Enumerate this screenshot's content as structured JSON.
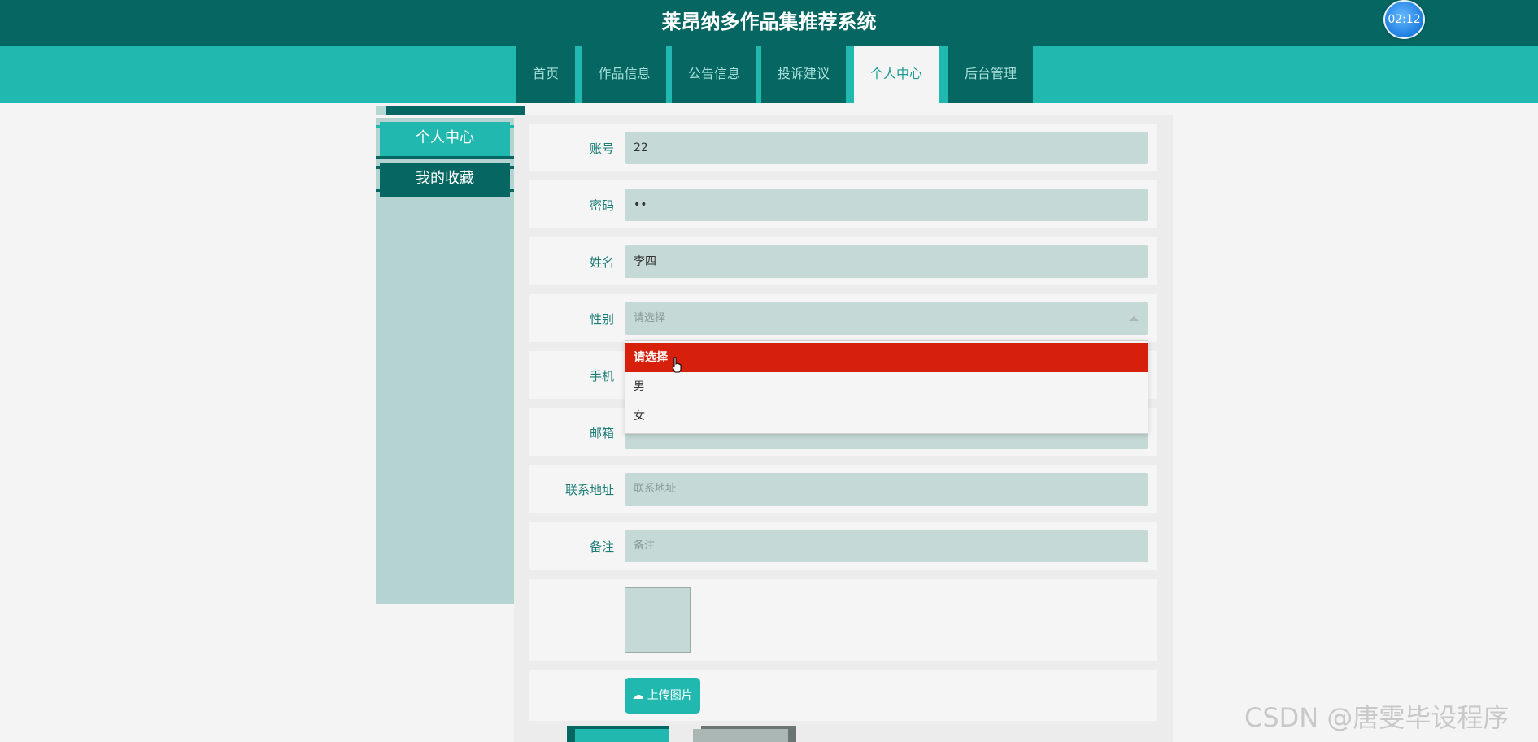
{
  "header": {
    "title": "莱昂纳多作品集推荐系统",
    "timer": "02:12"
  },
  "nav": {
    "items": [
      "首页",
      "作品信息",
      "公告信息",
      "投诉建议",
      "个人中心",
      "后台管理"
    ],
    "active": "个人中心"
  },
  "sidebar": {
    "items": [
      "个人中心",
      "我的收藏"
    ]
  },
  "form": {
    "account_label": "账号",
    "account_value": "22",
    "password_label": "密码",
    "password_value": "••",
    "name_label": "姓名",
    "name_value": "李四",
    "gender_label": "性别",
    "gender_placeholder": "请选择",
    "phone_label": "手机",
    "email_label": "邮箱",
    "address_label": "联系地址",
    "address_placeholder": "联系地址",
    "remark_label": "备注",
    "remark_placeholder": "备注",
    "upload_label": "上传图片"
  },
  "dropdown": {
    "options": [
      "请选择",
      "男",
      "女"
    ],
    "selected": "请选择"
  },
  "watermark": "CSDN @唐雯毕设程序",
  "colors": {
    "header": "#066762",
    "nav": "#21b8b0",
    "accent": "#21b8b0",
    "selected_option": "#d6200b"
  }
}
